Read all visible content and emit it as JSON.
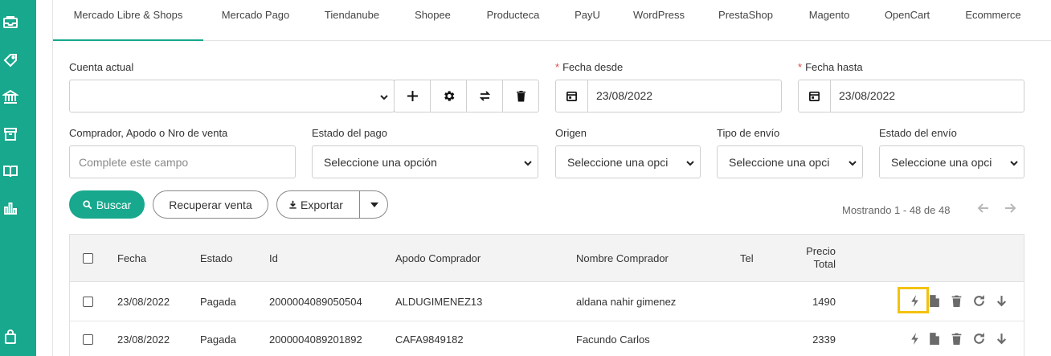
{
  "tabs": [
    {
      "label": "Mercado Libre & Shops",
      "active": true
    },
    {
      "label": "Mercado Pago"
    },
    {
      "label": "Tiendanube"
    },
    {
      "label": "Shopee"
    },
    {
      "label": "Producteca"
    },
    {
      "label": "PayU"
    },
    {
      "label": "WordPress"
    },
    {
      "label": "PrestaShop"
    },
    {
      "label": "Magento"
    },
    {
      "label": "OpenCart"
    },
    {
      "label": "Ecommerce"
    }
  ],
  "sidebar_icons": [
    "inbox-icon",
    "tag-icon",
    "bank-icon",
    "box-icon",
    "book-icon",
    "bar-chart-icon",
    "bag-icon"
  ],
  "filters": {
    "account_label": "Cuenta actual",
    "account_value": "",
    "date_from_label": "Fecha desde",
    "date_from_value": "23/08/2022",
    "date_to_label": "Fecha hasta",
    "date_to_value": "23/08/2022",
    "buyer_label": "Comprador, Apodo o Nro de venta",
    "buyer_placeholder": "Complete este campo",
    "payment_state_label": "Estado del pago",
    "payment_state_value": "Seleccione una opción",
    "origin_label": "Origen",
    "origin_value": "Seleccione una opci",
    "shipping_type_label": "Tipo de envío",
    "shipping_type_value": "Seleccione una opci",
    "shipping_state_label": "Estado del envío",
    "shipping_state_value": "Seleccione una opci",
    "required_mark": "*"
  },
  "actions": {
    "search_label": "Buscar",
    "recover_label": "Recuperar venta",
    "export_label": "Exportar"
  },
  "pager": {
    "text": "Mostrando 1 - 48 de 48"
  },
  "table": {
    "headers": {
      "fecha": "Fecha",
      "estado": "Estado",
      "id": "Id",
      "apodo": "Apodo Comprador",
      "nombre": "Nombre Comprador",
      "tel": "Tel",
      "precio_1": "Precio",
      "precio_2": "Total"
    },
    "rows": [
      {
        "fecha": "23/08/2022",
        "estado": "Pagada",
        "id": "2000004089050504",
        "apodo": "ALDUGIMENEZ13",
        "nombre": "aldana nahir gimenez",
        "tel": "",
        "precio": "1490"
      },
      {
        "fecha": "23/08/2022",
        "estado": "Pagada",
        "id": "2000004089201892",
        "apodo": "CAFA9849182",
        "nombre": "Facundo Carlos",
        "tel": "",
        "precio": "2339"
      }
    ]
  },
  "colors": {
    "accent": "#17a88d",
    "highlight": "#f4c20d",
    "required": "#e04848"
  }
}
